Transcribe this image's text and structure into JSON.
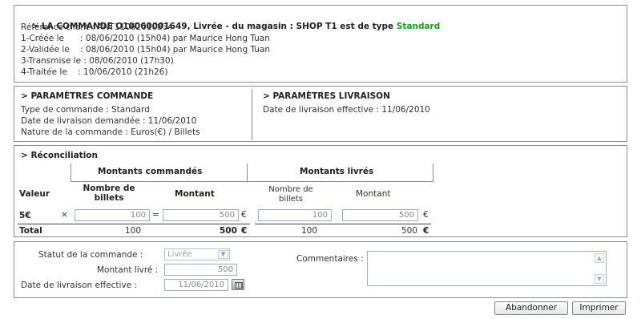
{
  "order": {
    "title_prefix": "> LA COMMANDE O10060001649, Livrée - du magasin : SHOP T1 est de type ",
    "type": "Standard",
    "client_ref": "Référence client : ANT11062010834",
    "steps": [
      "1-Créée le      : 08/06/2010 (15h04) par Maurice Hong Tuan",
      "2-Validée le    : 08/06/2010 (15h04) par Maurice Hong Tuan",
      "3-Transmise le : 08/06/2010 (17h30)",
      "4-Traitée le    : 10/06/2010 (21h26)"
    ]
  },
  "params_commande": {
    "title": "> PARAMÈTRES COMMANDE",
    "lines": [
      "Type de commande : Standard",
      "Date de livraison demandée : 11/06/2010",
      "Nature de la commande : Euros(€) / Billets"
    ]
  },
  "params_livraison": {
    "title": "> PARAMÈTRES LIVRAISON",
    "lines": [
      "Date de livraison effective : 11/06/2010"
    ]
  },
  "reconciliation": {
    "title": "> Réconciliation",
    "group_ordered": "Montants commandés",
    "group_delivered": "Montants livrés",
    "col_valeur": "Valeur",
    "col_nb_billets": "Nombre de\nbillets",
    "col_montant": "Montant",
    "col_nb_billets_livres": "Nombre de\nbillets",
    "col_montant_livres": "Montant",
    "row": {
      "valeur": "5€",
      "times": "×",
      "nb_billets": "100",
      "equals": "=",
      "montant": "500",
      "currency": "€",
      "nb_billets_livres": "100",
      "montant_livres": "500",
      "currency_livres": "€"
    },
    "total": {
      "label": "Total",
      "nb_billets": "100",
      "montant": "500",
      "currency": "€",
      "nb_billets_livres": "100",
      "montant_livres": "500",
      "currency_livres": "€"
    }
  },
  "form": {
    "statut_label": "Statut de la commande :",
    "statut_value": "Livrée",
    "montant_label": "Montant livré :",
    "montant_value": "500",
    "date_label": "Date de livraison effective :",
    "date_value": "11/06/2010",
    "comments_label": "Commentaires :"
  },
  "buttons": {
    "abandon": "Abandonner",
    "print": "Imprimer"
  },
  "colors": {
    "accent_green": "#1a9a1a",
    "border": "#8c8c8c",
    "input_border": "#9bb0c8"
  }
}
